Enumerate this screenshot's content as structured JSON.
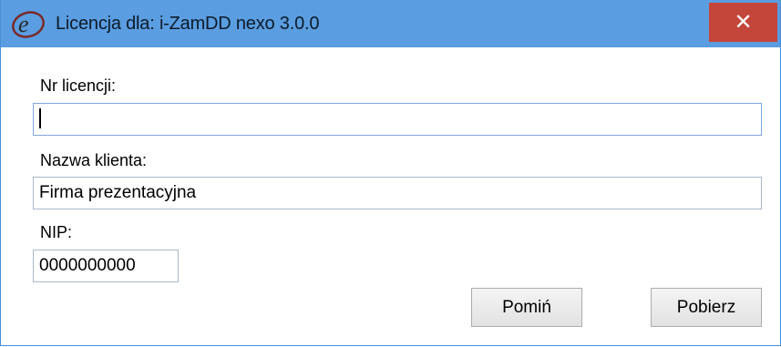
{
  "window": {
    "title": "Licencja dla: i-ZamDD nexo 3.0.0",
    "close_glyph": "✕"
  },
  "form": {
    "license_label": "Nr licencji:",
    "license_value": "",
    "client_label": "Nazwa klienta:",
    "client_value": "Firma prezentacyjna",
    "nip_label": "NIP:",
    "nip_value": "0000000000"
  },
  "buttons": {
    "skip_label": "Pomiń",
    "fetch_label": "Pobierz"
  },
  "colors": {
    "titlebar": "#5a9de0",
    "close": "#c4463a"
  }
}
